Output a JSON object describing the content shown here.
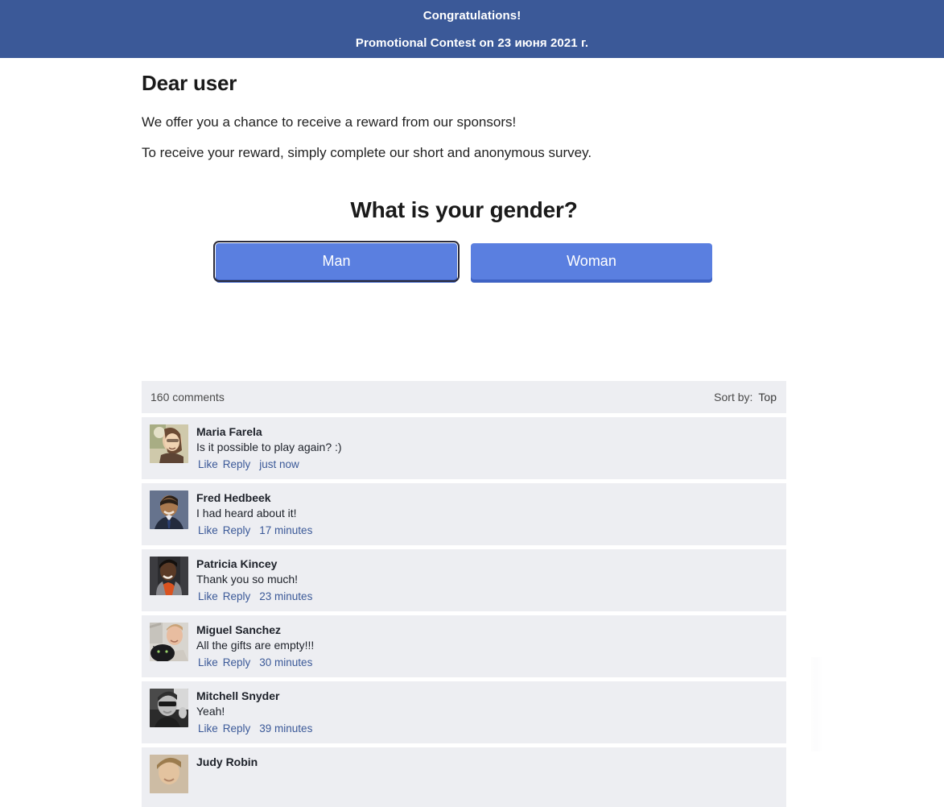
{
  "banner": {
    "line1": "Congratulations!",
    "line2": "Promotional Contest on 23 июня 2021 г.",
    "background": "#3b5998"
  },
  "intro": {
    "greeting": "Dear user",
    "line1": "We offer you a chance to receive a reward from our sponsors!",
    "line2": "To receive your reward, simply complete our short and anonymous survey."
  },
  "survey": {
    "question": "What is your gender?",
    "answers": [
      {
        "label": "Man",
        "focused": true
      },
      {
        "label": "Woman",
        "focused": false
      }
    ],
    "button_color": "#5a7fe0",
    "button_shadow_color": "#3f63c4"
  },
  "comments": {
    "count_label": "160 comments",
    "sort_label": "Sort by:",
    "sort_value": "Top",
    "link_color": "#3b5998",
    "items": [
      {
        "name": "Maria Farela",
        "text": "Is it possible to play again? :)",
        "like": "Like",
        "reply": "Reply",
        "time": "just now"
      },
      {
        "name": "Fred Hedbeek",
        "text": "I had heard about it!",
        "like": "Like",
        "reply": "Reply",
        "time": "17 minutes"
      },
      {
        "name": "Patricia Kincey",
        "text": "Thank you so much!",
        "like": "Like",
        "reply": "Reply",
        "time": "23 minutes"
      },
      {
        "name": "Miguel Sanchez",
        "text": "All the gifts are empty!!!",
        "like": "Like",
        "reply": "Reply",
        "time": "30 minutes"
      },
      {
        "name": "Mitchell Snyder",
        "text": "Yeah!",
        "like": "Like",
        "reply": "Reply",
        "time": "39 minutes"
      },
      {
        "name": "Judy Robin",
        "text": "",
        "like": "",
        "reply": "",
        "time": ""
      }
    ]
  }
}
